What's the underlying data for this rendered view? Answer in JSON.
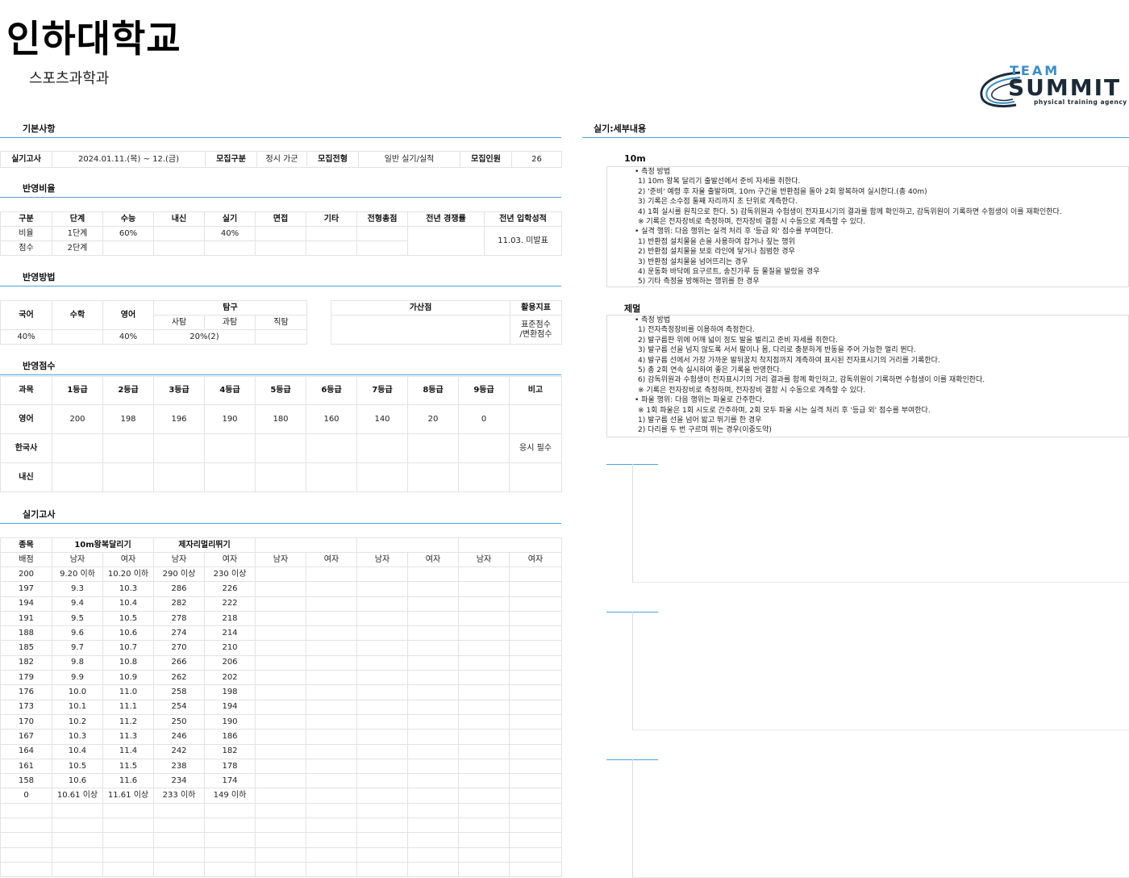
{
  "header": {
    "title": "인하대학교",
    "subtitle": "스포츠과학과"
  },
  "logo": {
    "team": "TEAM",
    "summit": "SUMMIT",
    "tagline": "physical training agency",
    "color_accent": "#3a8ec6",
    "color_dark": "#1c2a38"
  },
  "accent_color": "#4aa3d8",
  "sections": {
    "basic": "기본사항",
    "ratio": "반영비율",
    "method": "반영방법",
    "score": "반영점수",
    "practical": "실기고사",
    "detail": "실기:세부내용"
  },
  "basic": {
    "exam_label": "실기고사",
    "exam_date": "2024.01.11.(목) ~ 12.(금)",
    "type_label": "모집구분",
    "type_value": "정시 가군",
    "track_label": "모집전형",
    "track_value": "일반 실기/실적",
    "quota_label": "모집인원",
    "quota_value": "26"
  },
  "ratio": {
    "headers": [
      "구분",
      "단계",
      "수능",
      "내신",
      "실기",
      "면접",
      "기타",
      "전형총점",
      "전년 경쟁률",
      "전년 입학성적"
    ],
    "row1": [
      "비율",
      "1단계",
      "60%",
      "",
      "40%",
      "",
      "",
      "",
      ""
    ],
    "row2": [
      "점수",
      "2단계",
      "",
      "",
      "",
      "",
      "",
      "",
      ""
    ],
    "prev_score": "11.03. 미발표"
  },
  "method": {
    "korean": "국어",
    "math": "수학",
    "english": "영어",
    "inquiry": "탐구",
    "social": "사탐",
    "science": "과탐",
    "vocational": "직탐",
    "bonus": "가산점",
    "index": "활용지표",
    "korean_val": "40%",
    "math_val": "",
    "english_val": "40%",
    "inquiry_val": "20%(2)",
    "index_val1": "표준점수",
    "index_val2": "/변환점수"
  },
  "score": {
    "headers": [
      "과목",
      "1등급",
      "2등급",
      "3등급",
      "4등급",
      "5등급",
      "6등급",
      "7등급",
      "8등급",
      "9등급",
      "비고"
    ],
    "rows": [
      {
        "subject": "영어",
        "values": [
          "200",
          "198",
          "196",
          "190",
          "180",
          "160",
          "140",
          "20",
          "0"
        ],
        "note": ""
      },
      {
        "subject": "한국사",
        "values": [
          "",
          "",
          "",
          "",
          "",
          "",
          "",
          "",
          ""
        ],
        "note": "응시 필수"
      },
      {
        "subject": "내신",
        "values": [
          "",
          "",
          "",
          "",
          "",
          "",
          "",
          "",
          ""
        ],
        "note": ""
      }
    ]
  },
  "practical": {
    "event_label": "종목",
    "events": [
      "10m왕복달리기",
      "제자리멀리뛰기",
      "",
      "",
      ""
    ],
    "score_label": "배점",
    "male": "남자",
    "female": "여자",
    "rows": [
      [
        "200",
        "9.20 이하",
        "10.20 이하",
        "290 이상",
        "230 이상"
      ],
      [
        "197",
        "9.3",
        "10.3",
        "286",
        "226"
      ],
      [
        "194",
        "9.4",
        "10.4",
        "282",
        "222"
      ],
      [
        "191",
        "9.5",
        "10.5",
        "278",
        "218"
      ],
      [
        "188",
        "9.6",
        "10.6",
        "274",
        "214"
      ],
      [
        "185",
        "9.7",
        "10.7",
        "270",
        "210"
      ],
      [
        "182",
        "9.8",
        "10.8",
        "266",
        "206"
      ],
      [
        "179",
        "9.9",
        "10.9",
        "262",
        "202"
      ],
      [
        "176",
        "10.0",
        "11.0",
        "258",
        "198"
      ],
      [
        "173",
        "10.1",
        "11.1",
        "254",
        "194"
      ],
      [
        "170",
        "10.2",
        "11.2",
        "250",
        "190"
      ],
      [
        "167",
        "10.3",
        "11.3",
        "246",
        "186"
      ],
      [
        "164",
        "10.4",
        "11.4",
        "242",
        "182"
      ],
      [
        "161",
        "10.5",
        "11.5",
        "238",
        "178"
      ],
      [
        "158",
        "10.6",
        "11.6",
        "234",
        "174"
      ],
      [
        "0",
        "10.61 이상",
        "11.61 이상",
        "233 이하",
        "149 이하"
      ]
    ]
  },
  "details": [
    {
      "title": "10m",
      "lines": [
        "• 측정 방법",
        "1) 10m 왕복 달리기 출발선에서 준비 자세를 취한다.",
        "2) '준비' 예령 후 자율 출발하며, 10m 구간을 반환점을 돌아 2회 왕복하여 실시한다.(총 40m)",
        "3) 기록은 소수점 둘째 자리까지 초 단위로 계측한다.",
        "4) 1회 실시를 원칙으로 한다. 5) 감독위원과 수험생이 전자표시기의 결과를 함께 확인하고, 감독위원이 기록하면 수험생이 이를 재확인한다.",
        "※ 기록은 전자장비로 측정하며, 전자장비 결함 시 수동으로 계측할 수 있다.",
        "• 실격 행위: 다음 행위는 실격 처리 후 '등급 외' 점수를 부여한다.",
        "1) 반환점 설치물을 손을 사용하여 잡거나 짚는 행위",
        "2) 반환점 설치물을 보호 라인에 닿거나 침범한 경우",
        "3) 반환점 설치물을 넘어뜨리는 경우",
        "4) 운동화 바닥에 요구르트, 송진가루 등 물질을 발랐을 경우",
        "5) 기타 측정을 방해하는 행위를 한 경우"
      ]
    },
    {
      "title": "제멀",
      "lines": [
        "• 측정 방법",
        "1) 전자측정장비를 이용하여 측정한다.",
        "2) 발구름판 위에 어깨 넓이 정도 발을 벌리고 준비 자세를 취한다.",
        "3) 발구름 선을 넘지 않도록 서서 팔이나 몸, 다리로 충분하게 반동을 주어 가능한 멀리 뛴다.",
        "4) 발구름 선에서 가장 가까운 발뒤꿈치 착지점까지 계측하여 표시된 전자표시기의 거리를 기록한다.",
        "5) 총 2회 연속 실시하여 좋은 기록을 반영한다.",
        "6) 감독위원과 수험생이 전자표시기의 거리 결과를 함께 확인하고, 감독위원이 기록하면 수험생이 이를 재확인한다.",
        "※ 기록은 전자장비로 측정하며, 전자장비 결함 시 수동으로 계측할 수 있다.",
        "• 파울 행위: 다음 행위는 파울로 간주한다.",
        "※ 1회 파울은 1회 시도로 간주하며, 2회 모두 파울 시는 실격 처리 후 '등급 외' 점수를 부여한다.",
        "1) 발구름 선을 넘어 밟고 뛰기를 한 경우",
        "2) 다리를 두 번 구르며 뛰는 경우(이중도약)"
      ]
    }
  ]
}
